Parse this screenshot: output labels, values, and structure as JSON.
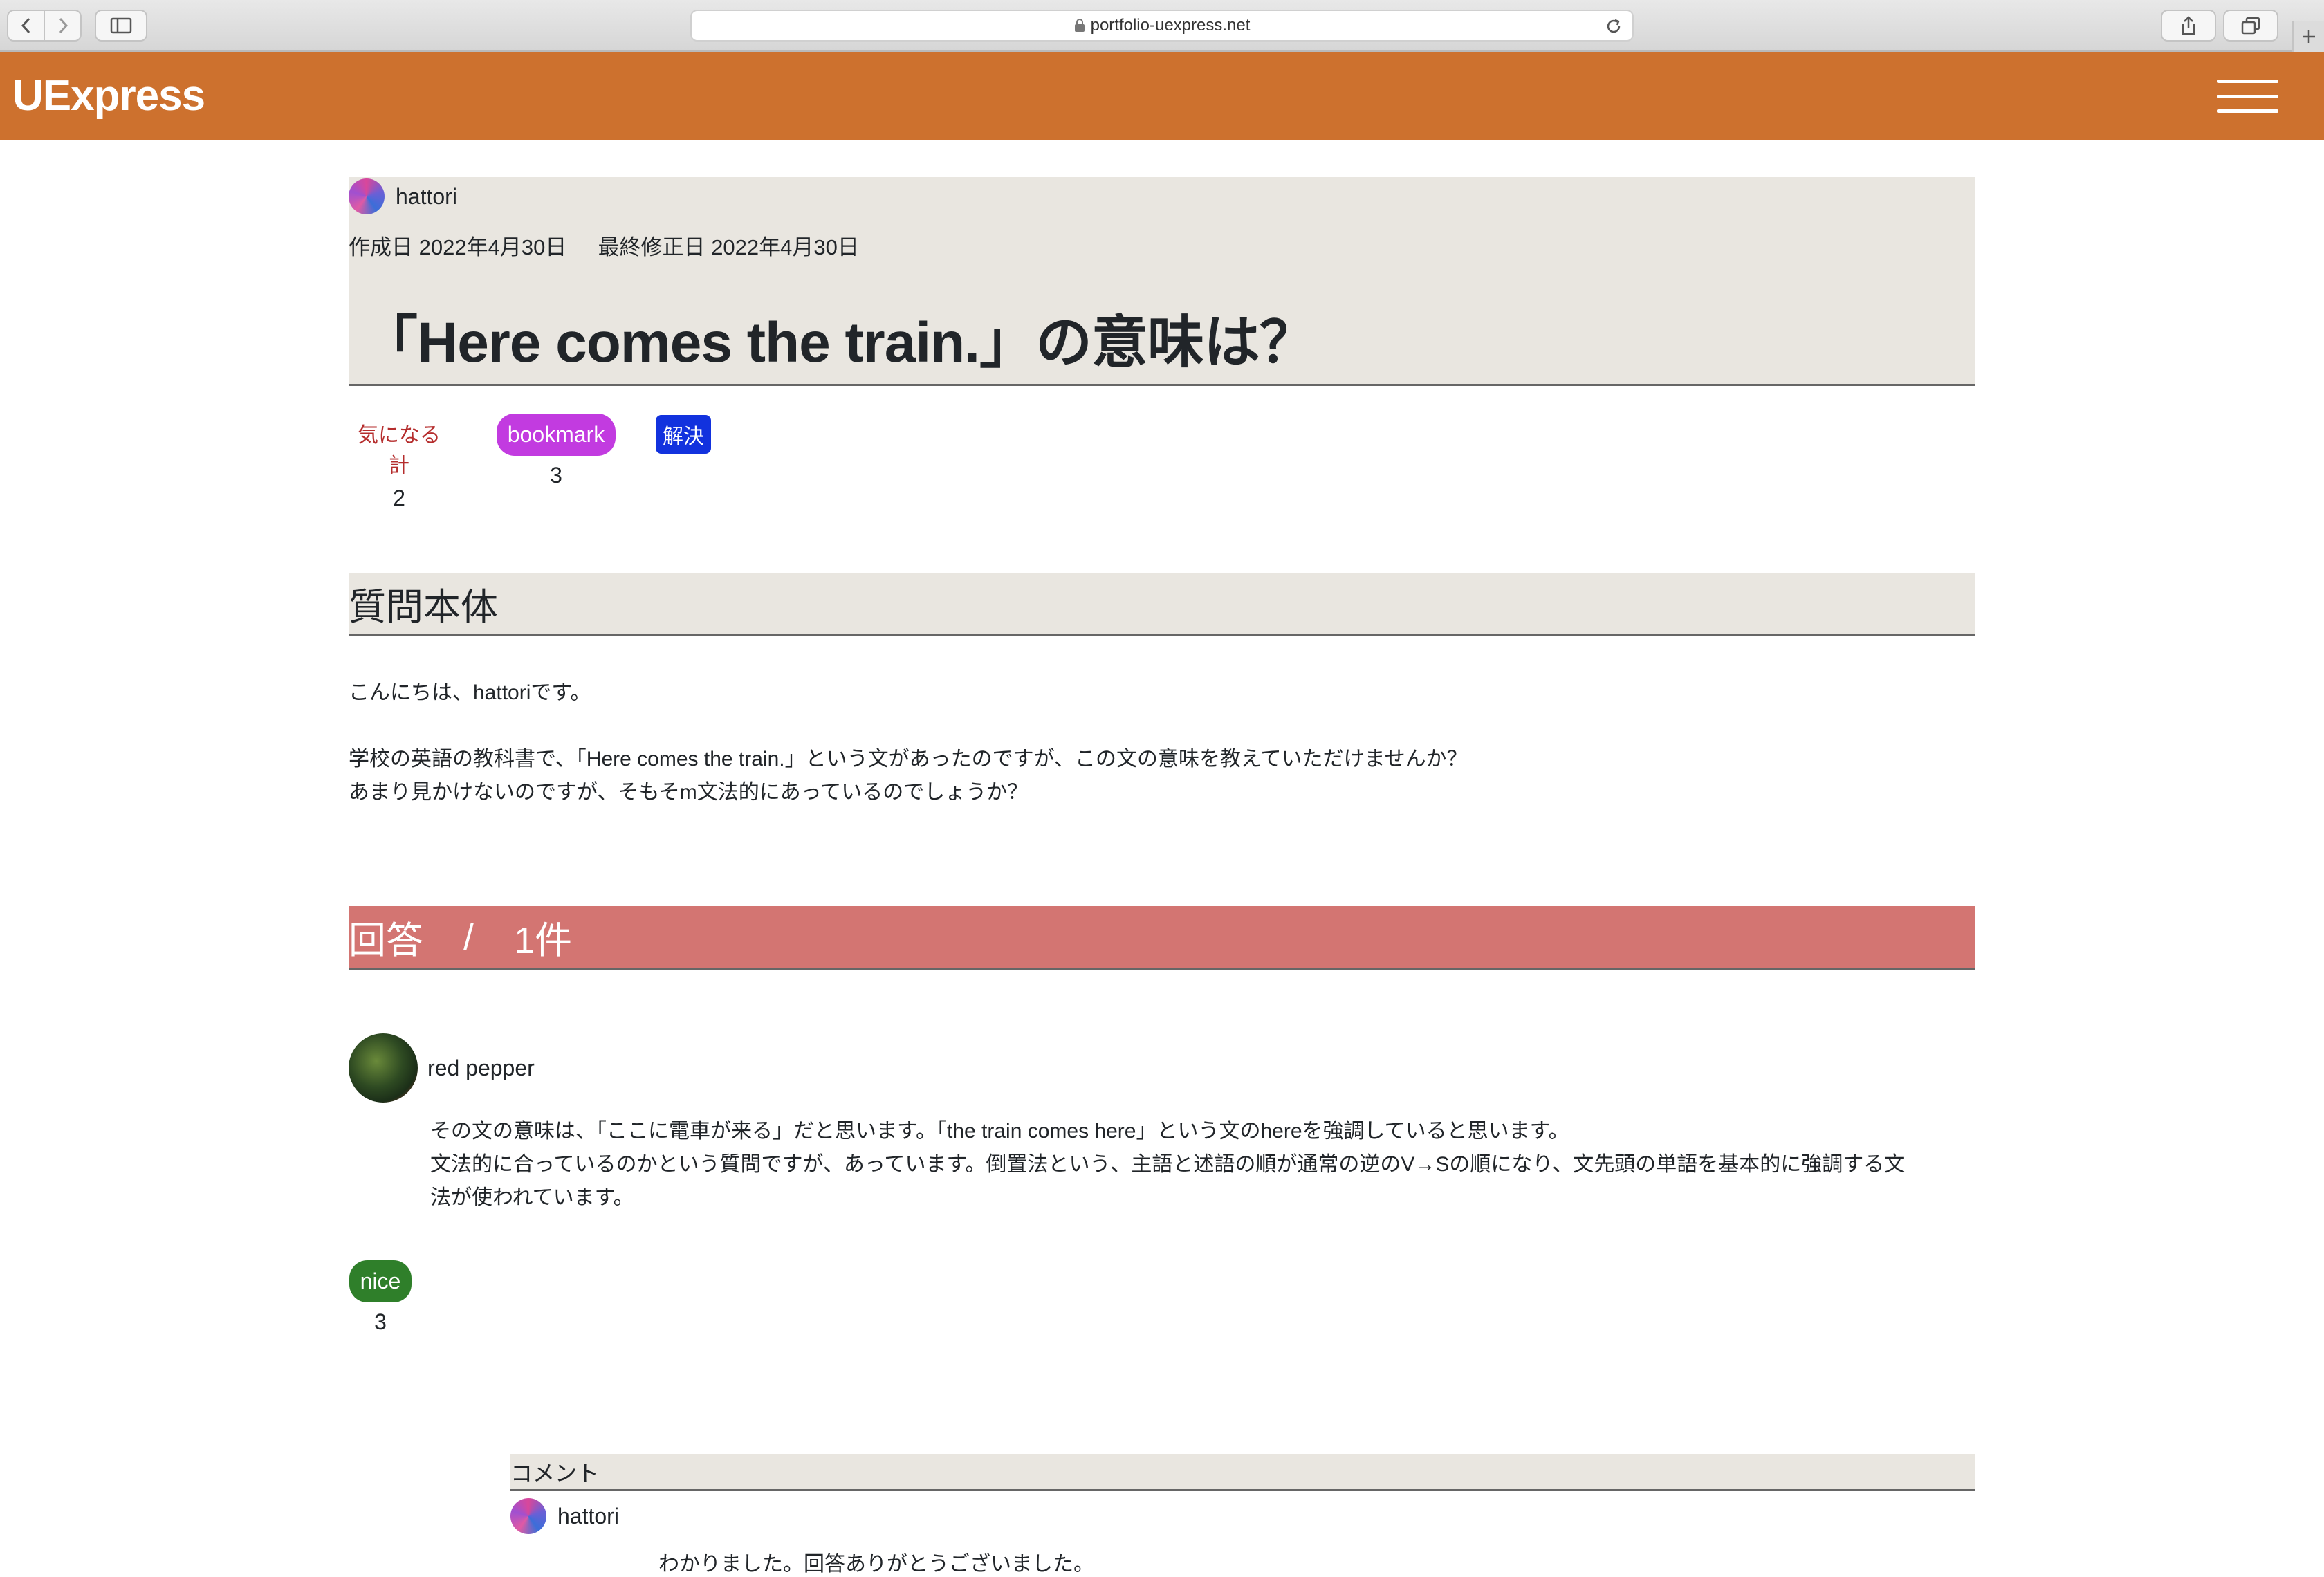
{
  "browser": {
    "url": "portfolio-uexpress.net",
    "icons": [
      "chevron-left-icon",
      "chevron-right-icon",
      "sidebar-icon",
      "lock-icon",
      "reload-icon",
      "share-icon",
      "tabs-icon",
      "plus-icon"
    ]
  },
  "header": {
    "brand": "UExpress",
    "accent_color": "#cd712e"
  },
  "question": {
    "author": "hattori",
    "created_label": "作成日",
    "created_date": "2022年4月30日",
    "modified_label": "最終修正日",
    "modified_date": "2022年4月30日",
    "title": "「Here comes the train.」の意味は？",
    "interest_label": "気になる計",
    "interest_count": "2",
    "bookmark_label": "bookmark",
    "bookmark_count": "3",
    "status_badge": "解決",
    "body_heading": "質問本体",
    "body_lines": [
      "こんにちは、hattoriです。",
      "学校の英語の教科書で、「Here comes the train.」という文があったのですが、この文の意味を教えていただけませんか？",
      "あまり見かけないのですが、そもそm文法的にあっているのでしょうか？"
    ]
  },
  "answers": {
    "heading": "回答",
    "separator": "/",
    "count_label": "1件",
    "items": [
      {
        "author": "red pepper",
        "lines": [
          "その文の意味は、「ここに電車が来る」だと思います。「the train comes here」という文のhereを強調していると思います。",
          "文法的に合っているのかという質問ですが、あっています。倒置法という、主語と述語の順が通常の逆のV→Sの順になり、文先頭の単語を基本的に強調する文",
          "法が使われています。"
        ],
        "nice_label": "nice",
        "nice_count": "3",
        "comment_heading": "コメント",
        "comment": {
          "author": "hattori",
          "text": "わかりました。回答ありがとうございました。"
        }
      }
    ]
  }
}
